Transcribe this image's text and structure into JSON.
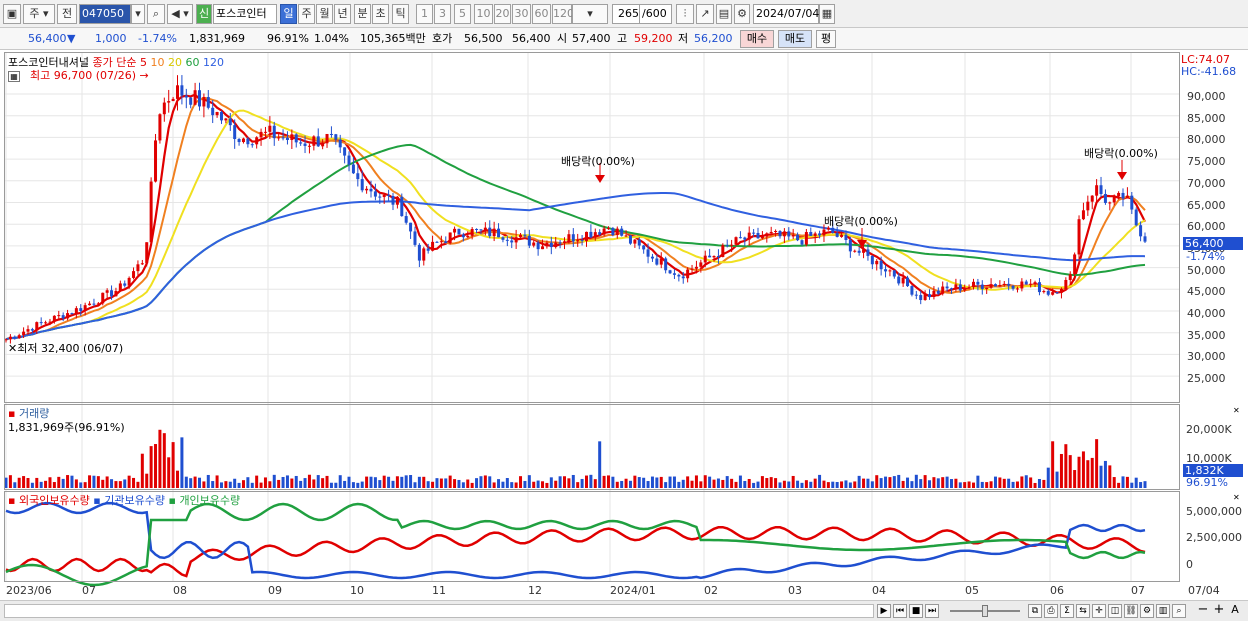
{
  "toolbar": {
    "type_label": "주",
    "prev_label": "전",
    "code": "047050",
    "new_label": "신",
    "stock_name": "포스코인터",
    "periods": [
      "일",
      "주",
      "월",
      "년",
      "분",
      "초",
      "틱"
    ],
    "ticks": [
      "1",
      "3",
      "5",
      "10",
      "20",
      "30",
      "60",
      "120"
    ],
    "count": "265",
    "count_total": "/600",
    "date": "2024/07/04"
  },
  "info": {
    "price": "56,400",
    "arrow": "▼",
    "change": "1,000",
    "change_pct": "-1.74%",
    "volume": "1,831,969",
    "volume_ratio": "96.91%",
    "turnover": "1.04%",
    "amount": "105,365백만",
    "hoga_label": "호가",
    "ask": "56,500",
    "bid": "56,400",
    "open_label": "시",
    "open": "57,400",
    "high_label": "고",
    "high": "59,200",
    "low_label": "저",
    "low": "56,200",
    "buy_label": "매수",
    "sell_label": "매도",
    "flat_label": "평"
  },
  "price_pane": {
    "name": "포스코인터내셔널",
    "ma_label": "종가 단순",
    "ma_periods": [
      "5",
      "10",
      "20",
      "60",
      "120"
    ],
    "high_note": "최고 96,700 (07/26)",
    "low_note": "최저 32,400 (06/07)",
    "lc": "LC:74.07",
    "hc": "HC:-41.68",
    "dividend_1": "배당락(0.00%)",
    "dividend_2": "배당락(0.00%)",
    "dividend_3": "배당락(0.00%)",
    "current_tag": "56,400",
    "current_pct": "-1.74%",
    "y_ticks": [
      "90,000",
      "85,000",
      "80,000",
      "75,000",
      "70,000",
      "65,000",
      "60,000",
      "55,000",
      "50,000",
      "45,000",
      "40,000",
      "35,000",
      "30,000",
      "25,000"
    ]
  },
  "volume_pane": {
    "title": "거래량",
    "value": "1,831,969주(96.91%)",
    "y_ticks": [
      "20,000K",
      "10,000K"
    ],
    "current_tag": "1,832K",
    "current_pct": "96.91%"
  },
  "holding_pane": {
    "legend": [
      "외국인보유수량",
      "기관보유수량",
      "개인보유수량"
    ],
    "y_ticks": [
      "5,000,000",
      "2,500,000",
      "0"
    ]
  },
  "x_axis": [
    "2023/06",
    "07",
    "08",
    "09",
    "10",
    "11",
    "12",
    "2024/01",
    "02",
    "03",
    "04",
    "05",
    "06",
    "07",
    "07/04"
  ],
  "colors": {
    "ma5": "#e00000",
    "ma10": "#f08020",
    "ma20": "#f0e020",
    "ma60": "#20a040",
    "ma120": "#3060e0",
    "up": "#e00000",
    "down": "#1f4fd0"
  }
}
